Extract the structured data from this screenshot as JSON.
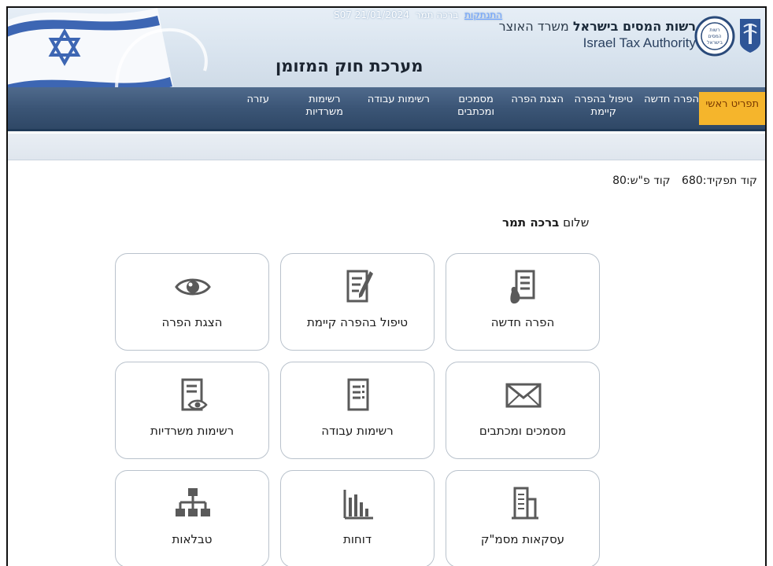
{
  "header": {
    "status_user": "ברכה תמר",
    "status_logout": "התנתקות",
    "status_code": "S07 21/01/2024",
    "system_title": "מערכת חוק המזומן",
    "authority_he_bold": "רשות המסים בישראל",
    "authority_he": "משרד האוצר",
    "authority_en": "Israel Tax Authority",
    "logo_text": "רשות המסים בישראל"
  },
  "nav": {
    "main_menu": "תפריט ראשי",
    "new_violation": "הפרה חדשה",
    "existing_line1": "טיפול בהפרה",
    "existing_line2": "קיימת",
    "show_violation": "הצגת הפרה",
    "docs_line1": "מסמכים",
    "docs_line2": "ומכתבים",
    "work_lists": "רשימות עבודה",
    "office_line1": "רשימות",
    "office_line2": "משרדיות",
    "help": "עזרה"
  },
  "info": {
    "role_code": "קוד תפקיד:680",
    "ps_code": "קוד פ\"ש:80",
    "greeting": "שלום",
    "user_name": "ברכה תמר"
  },
  "tiles": [
    {
      "label": "הפרה חדשה",
      "icon": "document-hand-icon"
    },
    {
      "label": "טיפול בהפרה קיימת",
      "icon": "document-pen-icon"
    },
    {
      "label": "הצגת הפרה",
      "icon": "eye-icon"
    },
    {
      "label": "מסמכים ומכתבים",
      "icon": "envelope-icon"
    },
    {
      "label": "רשימות עבודה",
      "icon": "document-list-icon"
    },
    {
      "label": "רשימות משרדיות",
      "icon": "document-eye-icon"
    },
    {
      "label": "עסקאות מסמ\"ק",
      "icon": "building-icon"
    },
    {
      "label": "דוחות",
      "icon": "bar-chart-icon"
    },
    {
      "label": "טבלאות",
      "icon": "org-chart-icon"
    }
  ],
  "colors": {
    "nav_bg": "#3b5576",
    "nav_active": "#f5b52c",
    "icon_gray": "#5a5a5a"
  }
}
